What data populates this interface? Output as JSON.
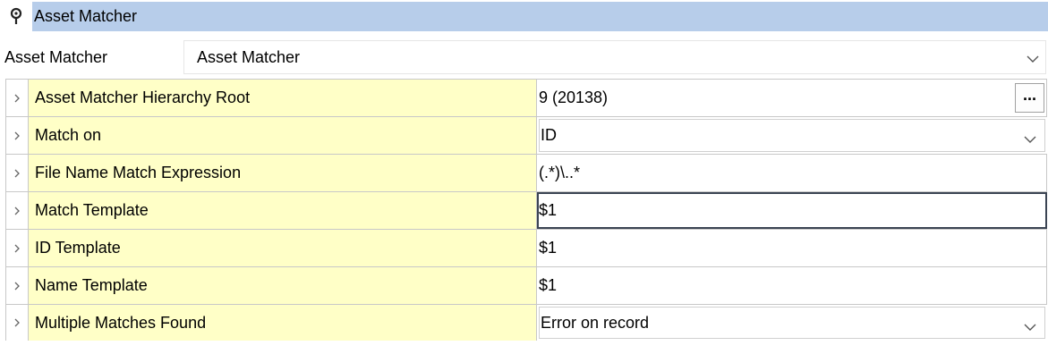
{
  "header": {
    "icon": "pin-icon",
    "title": "Asset Matcher"
  },
  "selector": {
    "label": "Asset Matcher",
    "value": "Asset Matcher"
  },
  "properties": [
    {
      "name": "Asset Matcher Hierarchy Root",
      "value": "9 (20138)",
      "button_label": "..."
    },
    {
      "name": "Match on",
      "value": "ID"
    },
    {
      "name": "File Name Match Expression",
      "value": "(.*)\\..*"
    },
    {
      "name": "Match Template",
      "value": "$1"
    },
    {
      "name": "ID Template",
      "value": "$1"
    },
    {
      "name": "Name Template",
      "value": "$1"
    },
    {
      "name": "Multiple Matches Found",
      "value": "Error on record"
    }
  ],
  "colors": {
    "header_bg": "#b7cdea",
    "name_cell_bg": "#ffffc7",
    "grid_line": "#c8c8c8"
  }
}
